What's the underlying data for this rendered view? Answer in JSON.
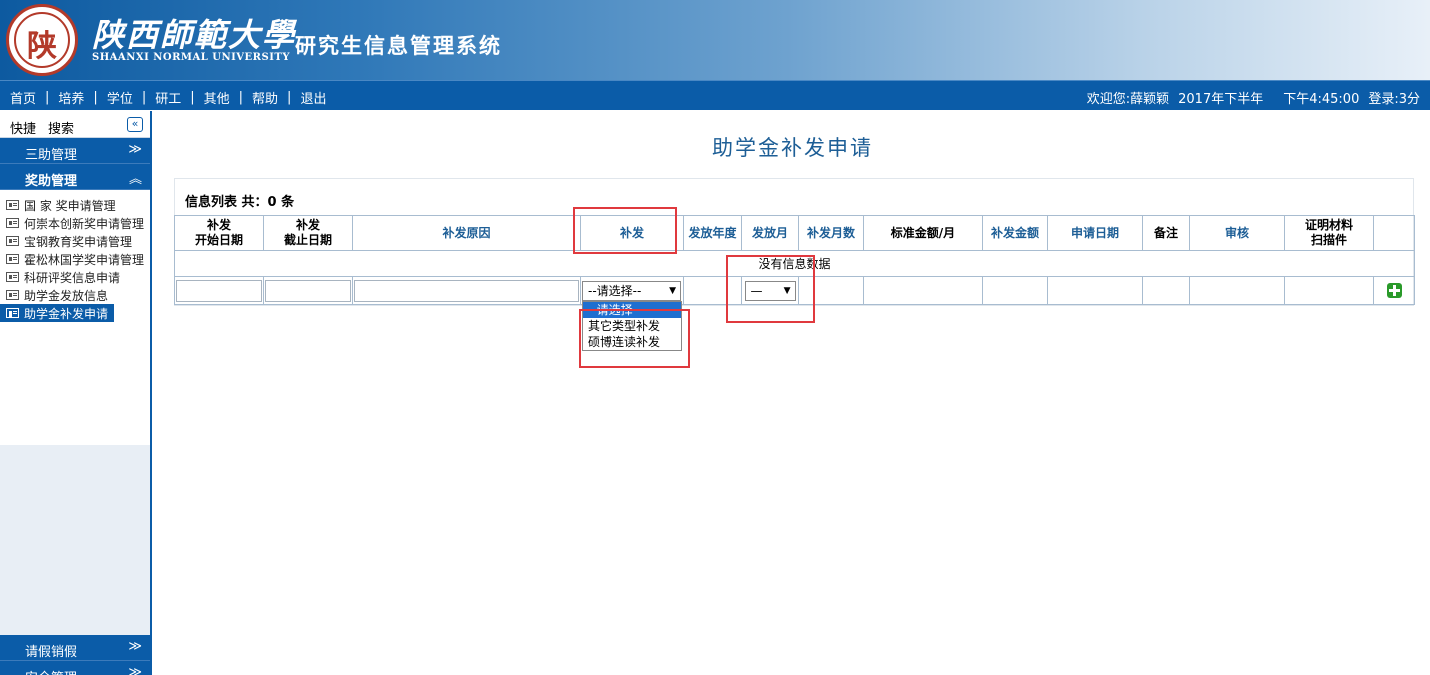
{
  "header": {
    "logo_char": "陕",
    "university_cn": "陕西師範大學",
    "university_en": "SHAANXI NORMAL UNIVERSITY",
    "system_name": "研究生信息管理系统"
  },
  "nav": {
    "items": [
      "首页",
      "培养",
      "学位",
      "研工",
      "其他",
      "帮助",
      "退出"
    ],
    "separator": "|",
    "welcome": "欢迎您:薛颖颖",
    "term": "2017年下半年",
    "time": "下午4:45:00",
    "login": "登录:3分"
  },
  "sidebar": {
    "quick": "快捷",
    "search": "搜索",
    "collapse": "«",
    "sections": {
      "sanzhu": "三助管理",
      "jiangzhu": "奖助管理",
      "leave": "请假销假",
      "safety": "安全管理"
    },
    "items": [
      "国 家 奖申请管理",
      "何崇本创新奖申请管理",
      "宝钢教育奖申请管理",
      "霍松林国学奖申请管理",
      "科研评奖信息申请",
      "助学金发放信息",
      "助学金补发申请"
    ]
  },
  "main": {
    "title": "助学金补发申请",
    "list_info": "信息列表 共：0 条",
    "columns": {
      "c1a": "补发",
      "c1b": "开始日期",
      "c2a": "补发",
      "c2b": "截止日期",
      "c3": "补发原因",
      "c4": "补发",
      "c5": "发放年度",
      "c6": "发放月",
      "c7": "补发月数",
      "c8": "标准金额/月",
      "c9": "补发金额",
      "c10": "申请日期",
      "c11": "备注",
      "c12": "审核",
      "c13a": "证明材料",
      "c13b": "扫描件"
    },
    "empty_text": "没有信息数据",
    "type_select_value": "--请选择--",
    "month_select_value": "—",
    "dropdown_options": [
      "--请选择--",
      "其它类型补发",
      "硕博连读补发"
    ]
  },
  "colors": {
    "primary": "#0b5ca8",
    "title": "#1d5e96",
    "highlight": "#e0393e"
  }
}
